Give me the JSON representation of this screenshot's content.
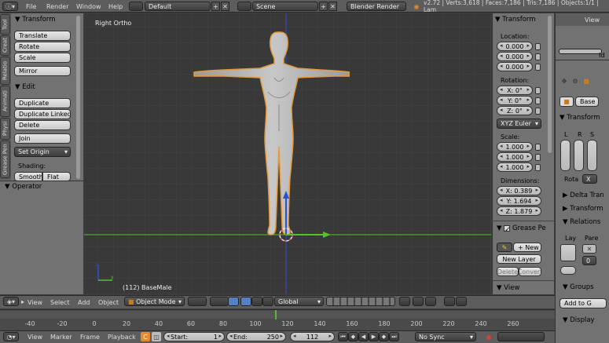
{
  "topbar": {
    "menus": [
      "File",
      "Render",
      "Window",
      "Help"
    ],
    "layout": "Default",
    "scene": "Scene",
    "engine": "Blender Render",
    "stats": "v2.72 | Verts:3,618 | Faces:7,186 | Tris:7,186 | Objects:1/1 | Lam"
  },
  "left_tabs": [
    "Tool",
    "Creat",
    "Relatio",
    "Animati",
    "Physi",
    "Grease Pen"
  ],
  "tools": {
    "transform_header": "Transform",
    "translate": "Translate",
    "rotate": "Rotate",
    "scale": "Scale",
    "mirror": "Mirror",
    "edit_header": "Edit",
    "duplicate": "Duplicate",
    "duplicate_linked": "Duplicate Linked",
    "delete": "Delete",
    "join": "Join",
    "set_origin": "Set Origin",
    "shading_label": "Shading:",
    "smooth": "Smooth",
    "flat": "Flat",
    "operator_header": "Operator"
  },
  "viewport": {
    "view_name": "Right Ortho",
    "object_label": "(112) BaseMale"
  },
  "npanel": {
    "transform_header": "Transform",
    "location_label": "Location:",
    "location": [
      "0.000",
      "0.000",
      "0.000"
    ],
    "rotation_label": "Rotation:",
    "rotation": [
      {
        "axis": "X:",
        "value": "0°"
      },
      {
        "axis": "Y:",
        "value": "0°"
      },
      {
        "axis": "Z:",
        "value": "0°"
      }
    ],
    "rotation_mode": "XYZ Euler",
    "scale_label": "Scale:",
    "scale": [
      "1.000",
      "1.000",
      "1.000"
    ],
    "dimensions_label": "Dimensions:",
    "dimensions": [
      {
        "axis": "X:",
        "value": "0.389"
      },
      {
        "axis": "Y:",
        "value": "1.694"
      },
      {
        "axis": "Z:",
        "value": "1.879"
      }
    ],
    "grease_header": "Grease Pe",
    "new": "New",
    "new_layer": "New Layer",
    "delete": "Delete",
    "convert": "Convert",
    "view_header": "View"
  },
  "properties": {
    "view_label": "View",
    "id_label": "Id",
    "base_name": "Base",
    "transform_header": "Transform",
    "lrs": [
      "L",
      "R",
      "S"
    ],
    "rota_label": "Rota",
    "rota_value": "X",
    "delta_header": "Delta Tran",
    "transform2_header": "Transform",
    "relations_header": "Relations",
    "lay_label": "Lay",
    "pare_label": "Pare",
    "pare_value": "0",
    "groups_header": "Groups",
    "add_to_group": "Add to G",
    "display_header": "Display"
  },
  "view3d_header": {
    "menus": [
      "View",
      "Select",
      "Add",
      "Object"
    ],
    "mode": "Object Mode",
    "orientation": "Global"
  },
  "timeline": {
    "ticks": [
      "-40",
      "-20",
      "0",
      "20",
      "40",
      "60",
      "80",
      "100",
      "120",
      "140",
      "160",
      "180",
      "200",
      "220",
      "240",
      "260"
    ],
    "current_frame_value": 112
  },
  "timeline_header": {
    "menus": [
      "View",
      "Marker",
      "Frame",
      "Playback"
    ],
    "start_label": "Start:",
    "start": "1",
    "end_label": "End:",
    "end": "250",
    "current": "112",
    "sync": "No Sync"
  },
  "colors": {
    "viewport_bg": "#393939",
    "panel_bg": "#727272",
    "header_bg": "#5d5d5d",
    "x_axis": "#58c02a",
    "y_axis": "#2a4fd0",
    "selection_outline": "#e59a3a",
    "frame_marker": "#56b83e"
  }
}
